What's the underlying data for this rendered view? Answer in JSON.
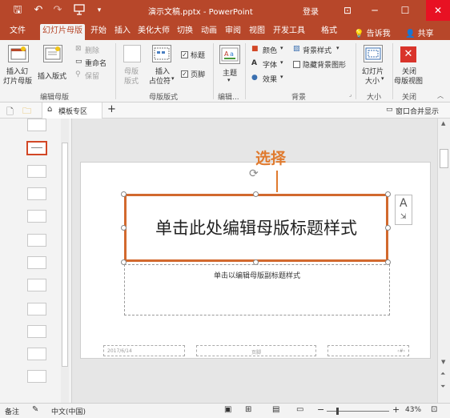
{
  "titlebar": {
    "doc_title": "演示文稿.pptx  -  PowerPoint",
    "signin": "登录",
    "save_glyph": "🖫",
    "undo_glyph": "↶",
    "redo_glyph": "↷",
    "customize_glyph": "▾",
    "ribbon_options_glyph": "⊡",
    "minimize_glyph": "─",
    "maximize_glyph": "☐",
    "close_glyph": "✕",
    "accent_color": "#b7472a"
  },
  "tabs": [
    {
      "label": "文件"
    },
    {
      "label": "幻灯片母版",
      "active": true
    },
    {
      "label": "开始"
    },
    {
      "label": "插入"
    },
    {
      "label": "美化大师"
    },
    {
      "label": "切换"
    },
    {
      "label": "动画"
    },
    {
      "label": "审阅"
    },
    {
      "label": "视图"
    },
    {
      "label": "开发工具"
    },
    {
      "label": "格式"
    }
  ],
  "tell_me": "告诉我",
  "share": "共享",
  "ribbon": {
    "edit_master": {
      "insert_master_line1": "插入幻",
      "insert_master_line2": "灯片母版",
      "insert_layout": "插入版式",
      "delete": "删除",
      "rename": "重命名",
      "preserve": "保留",
      "group": "编辑母版"
    },
    "master_layout": {
      "master_layout_line1": "母版",
      "master_layout_line2": "版式",
      "insert_placeholder_line1": "插入",
      "insert_placeholder_line2": "占位符",
      "title_check": "标题",
      "footer_check": "页脚",
      "group": "母版版式"
    },
    "edit_theme": {
      "themes": "主题",
      "group": "编辑..."
    },
    "background": {
      "colors": "颜色",
      "fonts": "字体",
      "effects": "效果",
      "bg_styles": "背景样式",
      "hide_bg": "隐藏背景图形",
      "group": "背景"
    },
    "size": {
      "slide_size_line1": "幻灯片",
      "slide_size_line2": "大小",
      "group": "大小"
    },
    "close": {
      "close_line1": "关闭",
      "close_line2": "母版视图",
      "group": "关闭"
    }
  },
  "subbar": {
    "tab_label": "模板专区",
    "add": "+",
    "right_label": "窗口合并显示"
  },
  "slide": {
    "title_text": "单击此处编辑母版标题样式",
    "subtitle_text": "单击以编辑母版副标题样式",
    "footer_date": "2017/6/14",
    "footer_center": "页脚",
    "annotation": "选择",
    "annotation_color": "#e07a2e",
    "selection_color": "#d2692e"
  },
  "status": {
    "notes": "备注",
    "language": "中文(中国)",
    "zoom": "43%",
    "zoom_minus": "−",
    "zoom_plus": "+"
  }
}
